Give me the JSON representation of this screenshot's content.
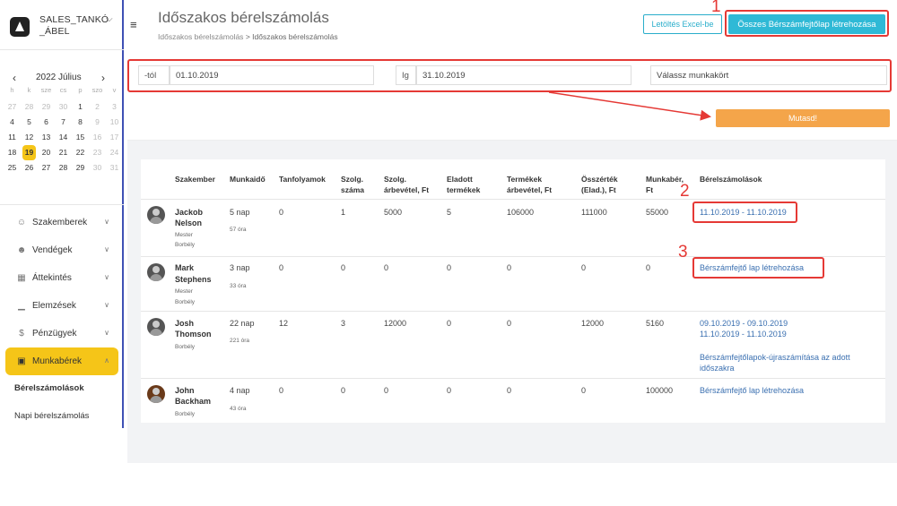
{
  "brand": {
    "name": "SALES_TANKÓ _ÁBEL"
  },
  "calendar": {
    "title": "2022 Július",
    "dow": [
      "h",
      "k",
      "sze",
      "cs",
      "p",
      "szo",
      "v"
    ],
    "weeks": [
      [
        "27",
        "28",
        "29",
        "30",
        "1",
        "2",
        "3"
      ],
      [
        "4",
        "5",
        "6",
        "7",
        "8",
        "9",
        "10"
      ],
      [
        "11",
        "12",
        "13",
        "14",
        "15",
        "16",
        "17"
      ],
      [
        "18",
        "19",
        "20",
        "21",
        "22",
        "23",
        "24"
      ],
      [
        "25",
        "26",
        "27",
        "28",
        "29",
        "30",
        "31"
      ]
    ],
    "today": "19"
  },
  "nav": {
    "items": [
      {
        "label": "Szakemberek",
        "icon": "user-icon"
      },
      {
        "label": "Vendégek",
        "icon": "users-icon"
      },
      {
        "label": "Áttekintés",
        "icon": "grid-icon"
      },
      {
        "label": "Elemzések",
        "icon": "chart-icon"
      },
      {
        "label": "Pénzügyek",
        "icon": "dollar-icon"
      },
      {
        "label": "Munkabérek",
        "icon": "wallet-icon"
      }
    ],
    "sub": [
      "Bérelszámolások",
      "Napi bérelszámolás"
    ]
  },
  "header": {
    "title": "Időszakos bérelszámolás",
    "breadcrumb": [
      "Időszakos bérelszámolás",
      ">",
      "Időszakos bérelszámolás"
    ],
    "excel_label": "Letöltés Excel-be",
    "create_all_label": "Összes Bérszámfejtőlap létrehozása"
  },
  "filter": {
    "from_label": "-tól",
    "from_value": "01.10.2019",
    "to_label": "Ig",
    "to_value": "31.10.2019",
    "job_placeholder": "Válassz munkakört",
    "show_label": "Mutasd!"
  },
  "annotations": [
    "1",
    "2",
    "3"
  ],
  "table": {
    "headers": [
      "Szakember",
      "Munkaidő",
      "Tanfolyamok",
      "Szolg. száma",
      "Szolg. árbevétel, Ft",
      "Eladott termékek",
      "Termékek árbevétel, Ft",
      "Összérték (Elad.), Ft",
      "Munkabér, Ft",
      "Bérelszámolások"
    ],
    "rows": [
      {
        "first": "Jackob",
        "last": "Nelson",
        "role1": "Mester",
        "role2": "Borbély",
        "days": "5 nap",
        "hours": "57 óra",
        "courses": "0",
        "services": "1",
        "svc_rev": "5000",
        "products": "5",
        "prod_rev": "106000",
        "total": "111000",
        "wage": "55000",
        "settle": [
          "11.10.2019 - 11.10.2019"
        ]
      },
      {
        "first": "Mark",
        "last": "Stephens",
        "role1": "Mester",
        "role2": "Borbély",
        "days": "3 nap",
        "hours": "33 óra",
        "courses": "0",
        "services": "0",
        "svc_rev": "0",
        "products": "0",
        "prod_rev": "0",
        "total": "0",
        "wage": "0",
        "settle": [
          "Bérszámfejtő lap létrehozása"
        ]
      },
      {
        "first": "Josh",
        "last": "Thomson",
        "role1": "Borbély",
        "role2": "",
        "days": "22 nap",
        "hours": "221 óra",
        "courses": "12",
        "services": "3",
        "svc_rev": "12000",
        "products": "0",
        "prod_rev": "0",
        "total": "12000",
        "wage": "5160",
        "settle": [
          "09.10.2019 - 09.10.2019",
          "11.10.2019 - 11.10.2019",
          "Bérszámfejtőlapok-újraszámítása az adott",
          "időszakra"
        ]
      },
      {
        "first": "John",
        "last": "Backham",
        "role1": "Borbély",
        "role2": "",
        "days": "4 nap",
        "hours": "43 óra",
        "courses": "0",
        "services": "0",
        "svc_rev": "0",
        "products": "0",
        "prod_rev": "0",
        "total": "0",
        "wage": "100000",
        "settle": [
          "Bérszámfejtő lap létrehozása"
        ]
      }
    ]
  },
  "colors": {
    "accent": "#2fb9d6",
    "highlight": "#e53935",
    "active_nav": "#f5c518",
    "show_button": "#f4a54a"
  }
}
